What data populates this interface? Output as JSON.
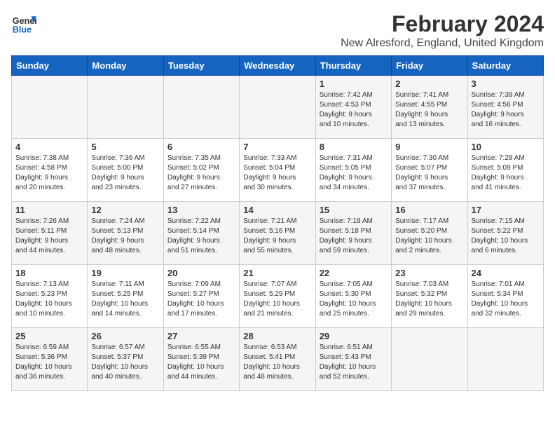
{
  "header": {
    "logo_general": "General",
    "logo_blue": "Blue",
    "month_year": "February 2024",
    "location": "New Alresford, England, United Kingdom"
  },
  "days_of_week": [
    "Sunday",
    "Monday",
    "Tuesday",
    "Wednesday",
    "Thursday",
    "Friday",
    "Saturday"
  ],
  "weeks": [
    [
      {
        "day": "",
        "info": ""
      },
      {
        "day": "",
        "info": ""
      },
      {
        "day": "",
        "info": ""
      },
      {
        "day": "",
        "info": ""
      },
      {
        "day": "1",
        "info": "Sunrise: 7:42 AM\nSunset: 4:53 PM\nDaylight: 9 hours\nand 10 minutes."
      },
      {
        "day": "2",
        "info": "Sunrise: 7:41 AM\nSunset: 4:55 PM\nDaylight: 9 hours\nand 13 minutes."
      },
      {
        "day": "3",
        "info": "Sunrise: 7:39 AM\nSunset: 4:56 PM\nDaylight: 9 hours\nand 16 minutes."
      }
    ],
    [
      {
        "day": "4",
        "info": "Sunrise: 7:38 AM\nSunset: 4:58 PM\nDaylight: 9 hours\nand 20 minutes."
      },
      {
        "day": "5",
        "info": "Sunrise: 7:36 AM\nSunset: 5:00 PM\nDaylight: 9 hours\nand 23 minutes."
      },
      {
        "day": "6",
        "info": "Sunrise: 7:35 AM\nSunset: 5:02 PM\nDaylight: 9 hours\nand 27 minutes."
      },
      {
        "day": "7",
        "info": "Sunrise: 7:33 AM\nSunset: 5:04 PM\nDaylight: 9 hours\nand 30 minutes."
      },
      {
        "day": "8",
        "info": "Sunrise: 7:31 AM\nSunset: 5:05 PM\nDaylight: 9 hours\nand 34 minutes."
      },
      {
        "day": "9",
        "info": "Sunrise: 7:30 AM\nSunset: 5:07 PM\nDaylight: 9 hours\nand 37 minutes."
      },
      {
        "day": "10",
        "info": "Sunrise: 7:28 AM\nSunset: 5:09 PM\nDaylight: 9 hours\nand 41 minutes."
      }
    ],
    [
      {
        "day": "11",
        "info": "Sunrise: 7:26 AM\nSunset: 5:11 PM\nDaylight: 9 hours\nand 44 minutes."
      },
      {
        "day": "12",
        "info": "Sunrise: 7:24 AM\nSunset: 5:13 PM\nDaylight: 9 hours\nand 48 minutes."
      },
      {
        "day": "13",
        "info": "Sunrise: 7:22 AM\nSunset: 5:14 PM\nDaylight: 9 hours\nand 51 minutes."
      },
      {
        "day": "14",
        "info": "Sunrise: 7:21 AM\nSunset: 5:16 PM\nDaylight: 9 hours\nand 55 minutes."
      },
      {
        "day": "15",
        "info": "Sunrise: 7:19 AM\nSunset: 5:18 PM\nDaylight: 9 hours\nand 59 minutes."
      },
      {
        "day": "16",
        "info": "Sunrise: 7:17 AM\nSunset: 5:20 PM\nDaylight: 10 hours\nand 2 minutes."
      },
      {
        "day": "17",
        "info": "Sunrise: 7:15 AM\nSunset: 5:22 PM\nDaylight: 10 hours\nand 6 minutes."
      }
    ],
    [
      {
        "day": "18",
        "info": "Sunrise: 7:13 AM\nSunset: 5:23 PM\nDaylight: 10 hours\nand 10 minutes."
      },
      {
        "day": "19",
        "info": "Sunrise: 7:11 AM\nSunset: 5:25 PM\nDaylight: 10 hours\nand 14 minutes."
      },
      {
        "day": "20",
        "info": "Sunrise: 7:09 AM\nSunset: 5:27 PM\nDaylight: 10 hours\nand 17 minutes."
      },
      {
        "day": "21",
        "info": "Sunrise: 7:07 AM\nSunset: 5:29 PM\nDaylight: 10 hours\nand 21 minutes."
      },
      {
        "day": "22",
        "info": "Sunrise: 7:05 AM\nSunset: 5:30 PM\nDaylight: 10 hours\nand 25 minutes."
      },
      {
        "day": "23",
        "info": "Sunrise: 7:03 AM\nSunset: 5:32 PM\nDaylight: 10 hours\nand 29 minutes."
      },
      {
        "day": "24",
        "info": "Sunrise: 7:01 AM\nSunset: 5:34 PM\nDaylight: 10 hours\nand 32 minutes."
      }
    ],
    [
      {
        "day": "25",
        "info": "Sunrise: 6:59 AM\nSunset: 5:36 PM\nDaylight: 10 hours\nand 36 minutes."
      },
      {
        "day": "26",
        "info": "Sunrise: 6:57 AM\nSunset: 5:37 PM\nDaylight: 10 hours\nand 40 minutes."
      },
      {
        "day": "27",
        "info": "Sunrise: 6:55 AM\nSunset: 5:39 PM\nDaylight: 10 hours\nand 44 minutes."
      },
      {
        "day": "28",
        "info": "Sunrise: 6:53 AM\nSunset: 5:41 PM\nDaylight: 10 hours\nand 48 minutes."
      },
      {
        "day": "29",
        "info": "Sunrise: 6:51 AM\nSunset: 5:43 PM\nDaylight: 10 hours\nand 52 minutes."
      },
      {
        "day": "",
        "info": ""
      },
      {
        "day": "",
        "info": ""
      }
    ]
  ]
}
